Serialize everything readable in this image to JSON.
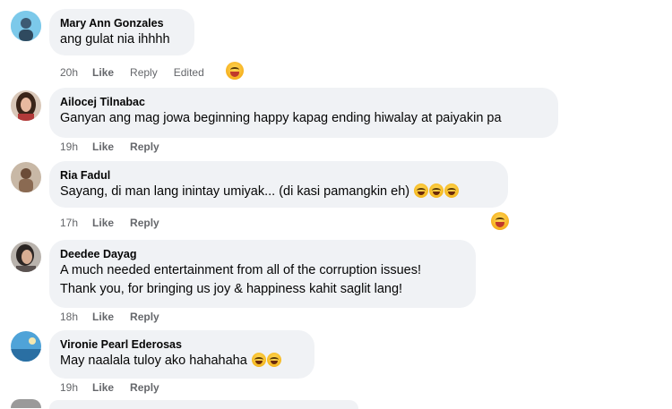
{
  "comments": [
    {
      "author": "Mary Ann Gonzales",
      "lines": [
        "ang gulat nia ihhhh"
      ],
      "time": "20h",
      "like": "Like",
      "reply": "Reply",
      "edited": "Edited",
      "reaction_icon": "haha-reaction-icon"
    },
    {
      "author": "Ailocej Tilnabac",
      "lines": [
        "Ganyan ang mag jowa beginning happy kapag ending hiwalay at paiyakin pa"
      ],
      "time": "19h",
      "like": "Like",
      "reply": "Reply"
    },
    {
      "author": "Ria Fadul",
      "lines": [
        "Sayang, di man lang inintay umiyak... (di kasi pamangkin eh)"
      ],
      "emoji_count": 3,
      "time": "17h",
      "like": "Like",
      "reply": "Reply",
      "reaction_icon": "haha-reaction-icon"
    },
    {
      "author": "Deedee Dayag",
      "lines": [
        "A much needed entertainment from all of the corruption issues!",
        "Thank you, for bringing us joy & happiness kahit saglit lang!"
      ],
      "time": "18h",
      "like": "Like",
      "reply": "Reply"
    },
    {
      "author": "Vironie Pearl Ederosas",
      "lines": [
        "May naalala tuloy ako hahahaha"
      ],
      "emoji_count": 2,
      "time": "19h",
      "like": "Like",
      "reply": "Reply"
    }
  ],
  "colors": {
    "bubble": "#f0f2f5",
    "meta": "#65676b",
    "text": "#050505"
  }
}
